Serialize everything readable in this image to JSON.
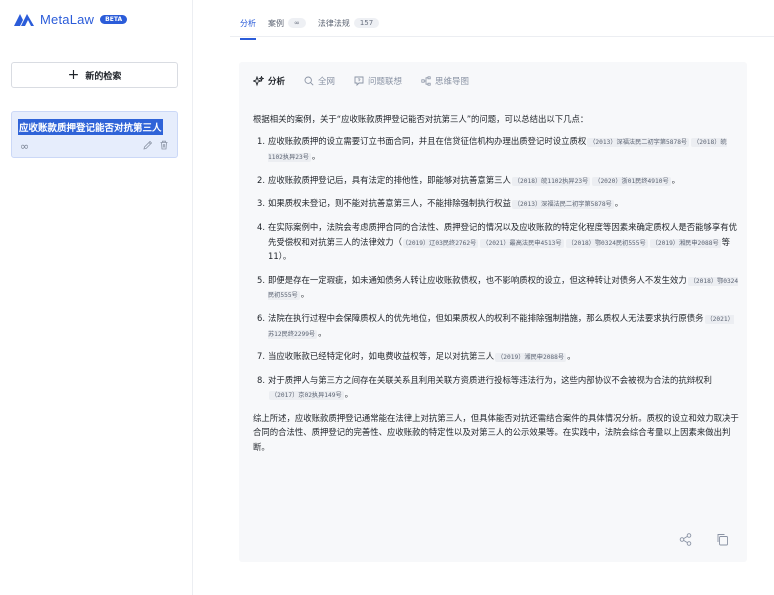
{
  "brand": {
    "name": "MetaLaw",
    "badge": "BETA",
    "color": "#2b5cd9"
  },
  "sidebar": {
    "new_search_label": "新的检索",
    "history": [
      {
        "title": "应收账款质押登记能否对抗第三人",
        "link_icon": "infinity-icon"
      }
    ]
  },
  "tabs": [
    {
      "label": "分析",
      "count": "",
      "active": true
    },
    {
      "label": "案例",
      "count": "∞",
      "active": false
    },
    {
      "label": "法律法规",
      "count": "157",
      "active": false
    }
  ],
  "subtabs": [
    {
      "label": "分析",
      "icon": "sparkle-icon",
      "active": true
    },
    {
      "label": "全网",
      "icon": "search-icon",
      "active": false
    },
    {
      "label": "问题联想",
      "icon": "question-bubble-icon",
      "active": false
    },
    {
      "label": "思维导图",
      "icon": "mindmap-icon",
      "active": false
    }
  ],
  "analysis": {
    "intro": "根据相关的案例，关于“应收账款质押登记能否对抗第三人”的问题，可以总结出以下几点：",
    "items": [
      {
        "num": "1.",
        "text": "应收账款质押的设立需要订立书面合同，并且在信贷征信机构办理出质登记时设立质权",
        "cites": [
          "（2013）深福法民二初字第5878号",
          "（2018）皖1102执异23号"
        ],
        "tail": "。"
      },
      {
        "num": "2.",
        "text": "应收账款质押登记后，具有法定的排他性，即能够对抗善意第三人",
        "cites": [
          "（2018）皖1102执异23号",
          "（2020）浙01民终4910号"
        ],
        "tail": "。"
      },
      {
        "num": "3.",
        "text": "如果质权未登记，则不能对抗善意第三人，不能排除强制执行权益",
        "cites": [
          "（2013）深福法民二初字第5878号"
        ],
        "tail": "。"
      },
      {
        "num": "4.",
        "text": "在实际案例中，法院会考虑质押合同的合法性、质押登记的情况以及应收账款的特定化程度等因素来确定质权人是否能够享有优先受偿权和对抗第三人的法律效力（",
        "cites": [
          "（2019）辽03民终2762号",
          "（2021）最高法民申4513号",
          "（2018）鄂0324民初555号",
          "（2019）湘民申2088号"
        ],
        "tail": "等11）。"
      },
      {
        "num": "5.",
        "text": "即便是存在一定瑕疵，如未通知债务人转让应收账款债权，也不影响质权的设立，但这种转让对债务人不发生效力",
        "cites": [
          "（2018）鄂0324民初555号"
        ],
        "tail": "。"
      },
      {
        "num": "6.",
        "text": "法院在执行过程中会保障质权人的优先地位，但如果质权人的权利不能排除强制措施，那么质权人无法要求执行原债务",
        "cites": [
          "（2021）苏12民终2299号"
        ],
        "tail": "。"
      },
      {
        "num": "7.",
        "text": "当应收账款已经特定化时，如电费收益权等，足以对抗第三人",
        "cites": [
          "（2019）湘民申2088号"
        ],
        "tail": "。"
      },
      {
        "num": "8.",
        "text": "对于质押人与第三方之间存在关联关系且利用关联方资质进行投标等违法行为，这些内部协议不会被视为合法的抗辩权利",
        "cites": [
          "（2017）京02执异149号"
        ],
        "tail": "。"
      }
    ],
    "summary": "综上所述，应收账款质押登记通常能在法律上对抗第三人，但具体能否对抗还需结合案件的具体情况分析。质权的设立和效力取决于合同的合法性、质押登记的完善性、应收账款的特定性以及对第三人的公示效果等。在实践中，法院会综合考量以上因素来做出判断。"
  }
}
